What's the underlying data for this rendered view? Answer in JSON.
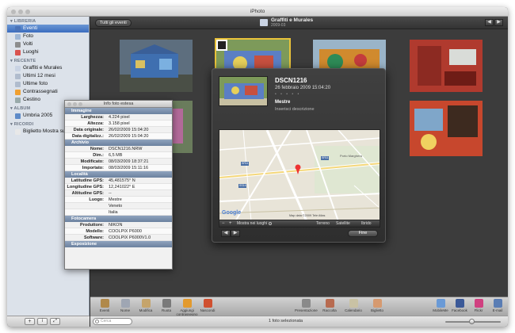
{
  "window": {
    "title": "iPhoto"
  },
  "sidebar": {
    "sections": [
      {
        "label": "LIBRERIA",
        "items": [
          {
            "label": "Eventi",
            "icon": "events-icon",
            "color": "#4a73b8",
            "selected": true
          },
          {
            "label": "Foto",
            "icon": "photos-icon",
            "color": "#9fb7d6"
          },
          {
            "label": "Volti",
            "icon": "faces-icon",
            "color": "#8d8d8d"
          },
          {
            "label": "Luoghi",
            "icon": "places-icon",
            "color": "#d9534f"
          }
        ]
      },
      {
        "label": "RECENTE",
        "items": [
          {
            "label": "Graffiti e Murales",
            "icon": "event-icon",
            "color": "#c9d3e3"
          },
          {
            "label": "Ultimi 12 mesi",
            "icon": "calendar-icon",
            "color": "#b0bccd"
          },
          {
            "label": "Ultime foto",
            "icon": "photo-icon",
            "color": "#b0bccd"
          },
          {
            "label": "Contrassegnati",
            "icon": "flag-icon",
            "color": "#f0a030"
          },
          {
            "label": "Cestino",
            "icon": "trash-icon",
            "color": "#9aa"
          }
        ]
      },
      {
        "label": "ALBUM",
        "items": [
          {
            "label": "Umbria 2005",
            "icon": "album-icon",
            "color": "#5d8ac8"
          }
        ]
      },
      {
        "label": "RICORDI",
        "items": [
          {
            "label": "Biglietto Mostra sul",
            "icon": "card-icon",
            "color": "#e8e8e8"
          }
        ]
      }
    ]
  },
  "header": {
    "all_events": "Tutti gli eventi",
    "event_title": "Graffiti e Murales",
    "event_sub": "2009-03",
    "prev": "◀",
    "next": "▶"
  },
  "info_panel": {
    "title": "Info foto estesa",
    "sections": [
      {
        "label": "Immagine",
        "rows": [
          {
            "label": "Larghezza:",
            "value": "4.224 pixel"
          },
          {
            "label": "Altezza:",
            "value": "3.158 pixel"
          },
          {
            "label": "Data originale:",
            "value": "26/02/2009 15:04:20"
          },
          {
            "label": "Data digitalizz.:",
            "value": "26/02/2009 15:04:20"
          }
        ]
      },
      {
        "label": "Archivio",
        "rows": [
          {
            "label": "Nome:",
            "value": "DSCN1216.NRW"
          },
          {
            "label": "Dim.:",
            "value": "6,5 MB"
          },
          {
            "label": "Modificato:",
            "value": "08/03/2009 18:37:21"
          },
          {
            "label": "Importato:",
            "value": "08/03/2009 15:11:16"
          }
        ]
      },
      {
        "label": "Località",
        "rows": [
          {
            "label": "Latitudine GPS:",
            "value": "45,481575° N"
          },
          {
            "label": "Longitudine GPS:",
            "value": "12,241022° E"
          },
          {
            "label": "Altitudine GPS:",
            "value": "--"
          },
          {
            "label": "Luogo:",
            "value": "Mestre"
          },
          {
            "label": "",
            "value": "Veneto"
          },
          {
            "label": "",
            "value": "Italia"
          }
        ]
      },
      {
        "label": "Fotocamera",
        "rows": [
          {
            "label": "Produttore:",
            "value": "NIKON"
          },
          {
            "label": "Modello:",
            "value": "COOLPIX P6000"
          },
          {
            "label": "Software:",
            "value": "COOLPIX P6000V1.0"
          }
        ]
      },
      {
        "label": "Esposizione",
        "rows": []
      }
    ]
  },
  "popup": {
    "name": "DSCN1216",
    "date": "26 febbraio 2009 15:04:20",
    "stars": "• • • • •",
    "location": "Mestre",
    "description": "Inserisci descrizione",
    "map": {
      "zoom_out": "−",
      "zoom_in": "+",
      "show_places": "Mostra nei luoghi",
      "modes": [
        "Terreno",
        "Satellite",
        "Ibrido"
      ],
      "google": "Google",
      "credit": "Map data ©2009 Tele Atlas",
      "label_town": "Porto Marghera",
      "road_labels": [
        "SR11",
        "SR11",
        "SS14"
      ]
    },
    "prev": "◀",
    "next": "▶",
    "done": "Fine"
  },
  "toolbar": {
    "left": [
      {
        "label": "Eventi",
        "icon": "events-icon",
        "color": "#b0894a"
      },
      {
        "label": "Nome",
        "icon": "name-icon",
        "color": "#9fa6b3"
      },
      {
        "label": "Modifica",
        "icon": "edit-icon",
        "color": "#c5a46b"
      },
      {
        "label": "Ruota",
        "icon": "rotate-icon",
        "color": "#7a7a7a"
      },
      {
        "label": "Aggiungi contrassegno",
        "icon": "flag-icon",
        "color": "#e39a2d"
      },
      {
        "label": "Nascondi",
        "icon": "hide-icon",
        "color": "#d05030"
      }
    ],
    "middle": [
      {
        "label": "Presentazione",
        "icon": "slideshow-icon",
        "color": "#8a8a8a"
      },
      {
        "label": "Raccolta",
        "icon": "book-icon",
        "color": "#b86b50"
      },
      {
        "label": "Calendario",
        "icon": "calendar-icon",
        "color": "#c9c2a4"
      },
      {
        "label": "Biglietto",
        "icon": "card-icon",
        "color": "#d69a70"
      }
    ],
    "right": [
      {
        "label": "MobileMe",
        "icon": "mobileme-icon",
        "color": "#6a9ad6"
      },
      {
        "label": "Facebook",
        "icon": "facebook-icon",
        "color": "#3b5998"
      },
      {
        "label": "Flickr",
        "icon": "flickr-icon",
        "color": "#d04080"
      },
      {
        "label": "E-mail",
        "icon": "email-icon",
        "color": "#5a7db4"
      }
    ]
  },
  "statusbar": {
    "search_placeholder": "Cerca",
    "status": "1 foto selezionata",
    "add": "+",
    "info": "i",
    "fullscreen": "⤢"
  }
}
